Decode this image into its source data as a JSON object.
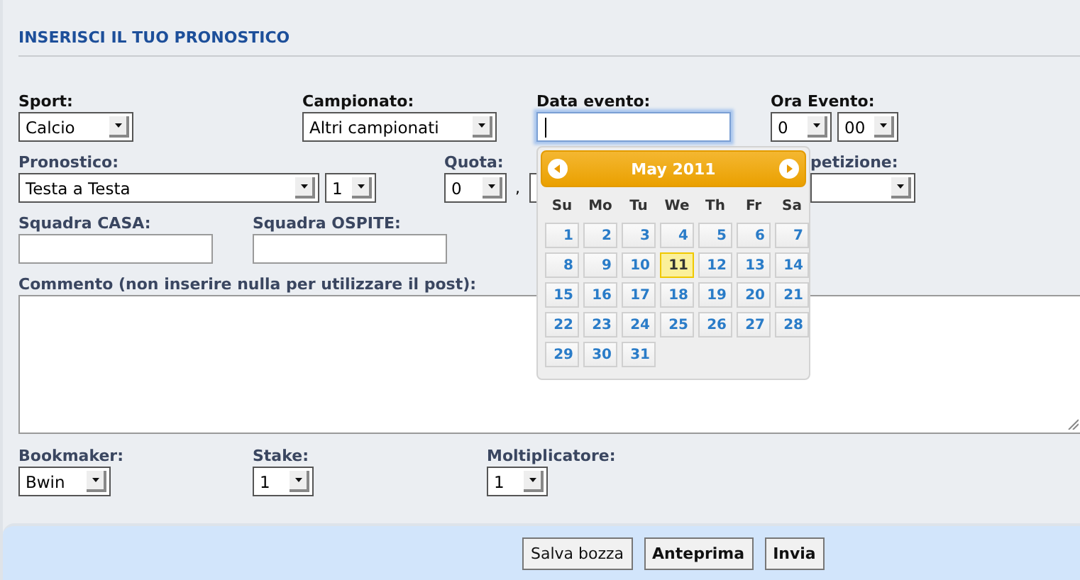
{
  "heading": "INSERISCI IL TUO PRONOSTICO",
  "rows": [
    {
      "fields": [
        {
          "label": "Sport:",
          "controls": [
            {
              "kind": "select",
              "value": "Calcio"
            }
          ]
        },
        {
          "label": "Campionato:",
          "controls": [
            {
              "kind": "select",
              "value": "Altri campionati"
            }
          ]
        },
        {
          "label": "Data evento:",
          "controls": [
            {
              "kind": "date",
              "focused": true
            }
          ]
        },
        {
          "label": "Ora Evento:",
          "controls": [
            {
              "kind": "select",
              "value": "0"
            },
            {
              "kind": "select",
              "value": "00"
            }
          ]
        }
      ]
    },
    {
      "fields": [
        {
          "label": "Pronostico:",
          "controls": [
            {
              "kind": "select",
              "value": "Testa a Testa"
            },
            {
              "kind": "select",
              "value": "1"
            }
          ]
        },
        {
          "label": "Quota:",
          "controls": [
            {
              "kind": "select",
              "value": "0"
            },
            {
              "kind": "separator",
              "text": ","
            },
            {
              "kind": "select"
            }
          ]
        },
        {
          "label": "petizione:",
          "controls": [
            {
              "kind": "select"
            }
          ]
        }
      ]
    },
    {
      "fields": [
        {
          "label": "Squadra CASA:",
          "controls": [
            {
              "kind": "text"
            }
          ]
        },
        {
          "label": "Squadra OSPITE:",
          "controls": [
            {
              "kind": "text"
            }
          ]
        }
      ]
    },
    {
      "fields": [
        {
          "label": "Commento (non inserire nulla per utilizzare il post):",
          "controls": [
            {
              "kind": "textarea"
            }
          ]
        }
      ]
    },
    {
      "fields": [
        {
          "label": "Bookmaker:",
          "controls": [
            {
              "kind": "select",
              "value": "Bwin"
            }
          ]
        },
        {
          "label": "Stake:",
          "controls": [
            {
              "kind": "select",
              "value": "1"
            }
          ]
        },
        {
          "label": "Moltiplicatore:",
          "controls": [
            {
              "kind": "select",
              "value": "1"
            }
          ]
        }
      ]
    }
  ],
  "buttons": [
    "Salva bozza",
    "Anteprima",
    "Invia"
  ],
  "calendar": {
    "month": "May 2011",
    "weekdays": [
      "Su",
      "Mo",
      "Tu",
      "We",
      "Th",
      "Fr",
      "Sa"
    ],
    "days": [
      {
        "day": "1",
        "selected": false
      },
      {
        "day": "2",
        "selected": false
      },
      {
        "day": "3",
        "selected": false
      },
      {
        "day": "4",
        "selected": false
      },
      {
        "day": "5",
        "selected": false
      },
      {
        "day": "6",
        "selected": false
      },
      {
        "day": "7",
        "selected": false
      },
      {
        "day": "8",
        "selected": false
      },
      {
        "day": "9",
        "selected": false
      },
      {
        "day": "10",
        "selected": false
      },
      {
        "day": "11",
        "selected": true
      },
      {
        "day": "12",
        "selected": false
      },
      {
        "day": "13",
        "selected": false
      },
      {
        "day": "14",
        "selected": false
      },
      {
        "day": "15",
        "selected": false
      },
      {
        "day": "16",
        "selected": false
      },
      {
        "day": "17",
        "selected": false
      },
      {
        "day": "18",
        "selected": false
      },
      {
        "day": "19",
        "selected": false
      },
      {
        "day": "20",
        "selected": false
      },
      {
        "day": "21",
        "selected": false
      },
      {
        "day": "22",
        "selected": false
      },
      {
        "day": "23",
        "selected": false
      },
      {
        "day": "24",
        "selected": false
      },
      {
        "day": "25",
        "selected": false
      },
      {
        "day": "26",
        "selected": false
      },
      {
        "day": "27",
        "selected": false
      },
      {
        "day": "28",
        "selected": false
      },
      {
        "day": "29",
        "selected": false
      },
      {
        "day": "30",
        "selected": false
      },
      {
        "day": "31",
        "selected": false
      }
    ]
  }
}
